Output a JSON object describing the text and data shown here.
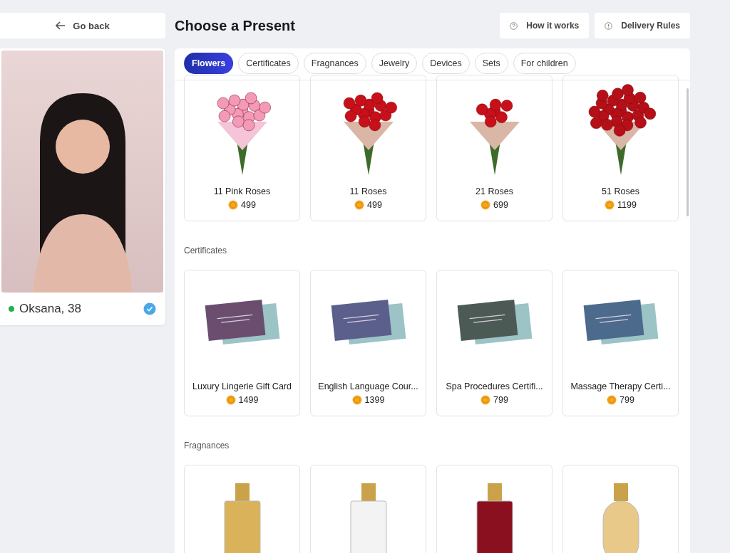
{
  "back_button": {
    "label": "Go back"
  },
  "page_title": "Choose a Present",
  "header_buttons": [
    {
      "label": "How it works",
      "kind": "help"
    },
    {
      "label": "Delivery Rules",
      "kind": "info"
    }
  ],
  "profile": {
    "name": "Oksana, 38",
    "online": true,
    "verified": true
  },
  "tabs": [
    {
      "label": "Flowers",
      "selected": true
    },
    {
      "label": "Certificates",
      "selected": false
    },
    {
      "label": "Fragnances",
      "selected": false
    },
    {
      "label": "Jewelry",
      "selected": false
    },
    {
      "label": "Devices",
      "selected": false
    },
    {
      "label": "Sets",
      "selected": false
    },
    {
      "label": "For children",
      "selected": false
    }
  ],
  "sections": [
    {
      "kind": "bouquet",
      "items": [
        {
          "name": "11 Pink Roses",
          "price": "499"
        },
        {
          "name": "11 Roses",
          "price": "499"
        },
        {
          "name": "21 Roses",
          "price": "699"
        },
        {
          "name": "51 Roses",
          "price": "1199"
        }
      ]
    },
    {
      "kind": "certificate",
      "heading": "Certificates",
      "items": [
        {
          "name": "Luxury Lingerie Gift Card",
          "price": "1499"
        },
        {
          "name": "English Language Cour...",
          "price": "1399"
        },
        {
          "name": "Spa Procedures Certifi...",
          "price": "799"
        },
        {
          "name": "Massage Therapy Certi...",
          "price": "799"
        }
      ]
    },
    {
      "kind": "perfume",
      "heading": "Fragnances",
      "items": [
        {
          "kind": "tall-bottle"
        },
        {
          "kind": "tall-bottle"
        },
        {
          "kind": "tall-bottle"
        },
        {
          "kind": "round-bottle"
        }
      ]
    }
  ]
}
